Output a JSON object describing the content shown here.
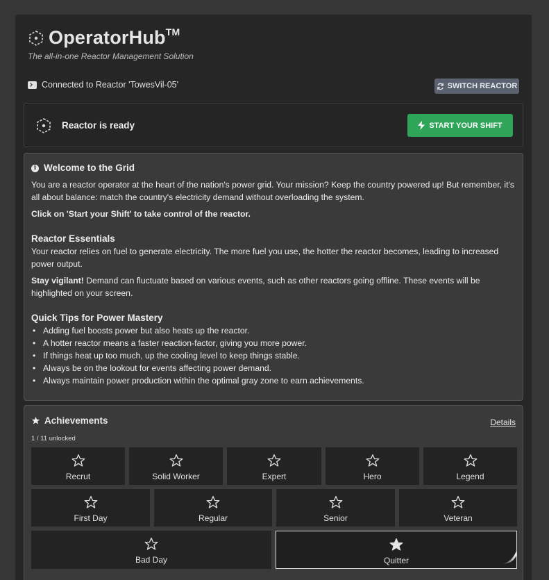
{
  "app": {
    "title": "OperatorHub",
    "trademark": "TM",
    "subtitle": "The all-in-one Reactor Management Solution"
  },
  "connection": {
    "text": "Connected to Reactor 'TowesVil-05'",
    "switch_label": "SWITCH REACTOR"
  },
  "status": {
    "text": "Reactor is ready",
    "start_label": "START YOUR SHIFT"
  },
  "welcome": {
    "heading": "Welcome to the Grid",
    "intro": "You are a reactor operator at the heart of the nation's power grid. Your mission? Keep the country powered up! But remember, it's all about balance: match the country's electricity demand without overloading the system.",
    "cta": "Click on 'Start your Shift' to take control of the reactor.",
    "essentials_heading": "Reactor Essentials",
    "essentials_text": "Your reactor relies on fuel to generate electricity. The more fuel you use, the hotter the reactor becomes, leading to increased power output.",
    "vigilant_bold": "Stay vigilant!",
    "vigilant_text": " Demand can fluctuate based on various events, such as other reactors going offline. These events will be highlighted on your screen.",
    "tips_heading": "Quick Tips for Power Mastery",
    "tips": [
      "Adding fuel boosts power but also heats up the reactor.",
      "A hotter reactor means a faster reaction-factor, giving you more power.",
      "If things heat up too much, up the cooling level to keep things stable.",
      "Always be on the lookout for events affecting power demand.",
      "Always maintain power production within the optimal gray zone to earn achievements."
    ]
  },
  "achievements": {
    "heading": "Achievements",
    "details_label": "Details",
    "count_text": "1 / 11 unlocked",
    "items": [
      {
        "label": "Recrut",
        "unlocked": false
      },
      {
        "label": "Solid Worker",
        "unlocked": false
      },
      {
        "label": "Expert",
        "unlocked": false
      },
      {
        "label": "Hero",
        "unlocked": false
      },
      {
        "label": "Legend",
        "unlocked": false
      },
      {
        "label": "First Day",
        "unlocked": false
      },
      {
        "label": "Regular",
        "unlocked": false
      },
      {
        "label": "Senior",
        "unlocked": false
      },
      {
        "label": "Veteran",
        "unlocked": false
      },
      {
        "label": "Bad Day",
        "unlocked": false
      },
      {
        "label": "Quitter",
        "unlocked": true
      }
    ]
  },
  "colors": {
    "accent_green": "#2fa55a",
    "switch_button": "#5a6270"
  },
  "icons": {
    "logo": "reactor-icon",
    "connection": "terminal-icon",
    "switch": "refresh-icon",
    "start": "lightning-icon",
    "welcome": "info-icon",
    "achievements": "star-icon"
  }
}
